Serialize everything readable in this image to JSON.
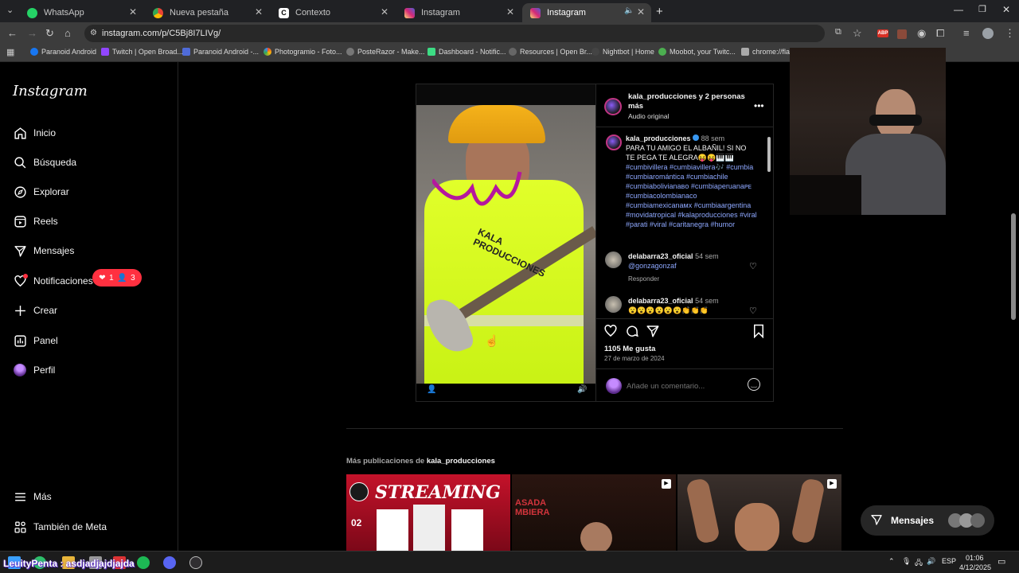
{
  "browser": {
    "tabs": [
      {
        "label": "WhatsApp",
        "icon": "whatsapp-icon",
        "color": "#25d366"
      },
      {
        "label": "Nueva pestaña",
        "icon": "chrome-icon",
        "color": "#4285f4"
      },
      {
        "label": "Contexto",
        "icon": "contexto-icon",
        "color": "#ffffff"
      },
      {
        "label": "Instagram",
        "icon": "instagram-icon",
        "color": "#e1306c"
      },
      {
        "label": "Instagram",
        "icon": "instagram-icon",
        "color": "#e1306c"
      }
    ],
    "url": "instagram.com/p/C5Bj8I7LIVg/",
    "bookmarks": [
      "Paranoid Android",
      "Twitch | Open Broad...",
      "Paranoid Android -...",
      "Photogramio - Foto...",
      "PosteRazor - Make...",
      "Dashboard - Notific...",
      "Resources | Open Br...",
      "Nightbot | Home",
      "Moobot, your Twitc...",
      "chrome://flag..."
    ]
  },
  "sidebar": {
    "logo": "Instagram",
    "items": [
      {
        "label": "Inicio",
        "icon": "home-icon"
      },
      {
        "label": "Búsqueda",
        "icon": "search-icon"
      },
      {
        "label": "Explorar",
        "icon": "compass-icon"
      },
      {
        "label": "Reels",
        "icon": "reels-icon"
      },
      {
        "label": "Mensajes",
        "icon": "messages-icon"
      },
      {
        "label": "Notificaciones",
        "icon": "heart-icon"
      },
      {
        "label": "Crear",
        "icon": "plus-icon"
      },
      {
        "label": "Panel",
        "icon": "chart-icon"
      },
      {
        "label": "Perfil",
        "icon": "avatar-icon"
      }
    ],
    "notif_likes": "1",
    "notif_follows": "3",
    "more": "Más",
    "meta": "También de Meta"
  },
  "post": {
    "header_user": "kala_producciones y 2 personas más",
    "audio": "Audio original",
    "author": "kala_producciones",
    "author_time": "88 sem",
    "caption_text": "PARA TU AMIGO EL ALBAÑIL! SI NO TE PEGA TE ALEGRA😝😝🎹🎹",
    "caption_tags": "#cumbivillera #cumbiavillera🎶 #cumbia #cumbiaromántica #cumbiachile #cumbiabolivianaвo #cumbiaperuanaᴘᴇ #cumbiacolombianaco #cumbiamexicanaмx #cumbiaargentina #movidatropical #kalaproducciones #viral #parati #viral #caritanegra #humor",
    "comments": [
      {
        "user": "delabarra23_oficial",
        "time": "54 sem",
        "text": "@gonzagonzaf",
        "reply": "Responder"
      },
      {
        "user": "delabarra23_oficial",
        "time": "54 sem",
        "text": "😮😮😮😮😮😮👏👏👏"
      }
    ],
    "likes": "1105 Me gusta",
    "date": "27 de marzo de 2024",
    "comment_placeholder": "Añade un comentario...",
    "media_overlay_text": "KALA PRODUCCIONES"
  },
  "more_posts": {
    "prefix": "Más publicaciones de",
    "user": "kala_producciones",
    "thumb1_text": "STREAMING",
    "thumb1_date": "02",
    "thumb2_text": "ASADA MBIERA"
  },
  "messages_pill": "Mensajes",
  "taskbar": {
    "stream_text": "LeuityPenta : asdjadjajdjajda",
    "lang": "ESP",
    "time": "01:06",
    "date": "4/12/2025"
  }
}
